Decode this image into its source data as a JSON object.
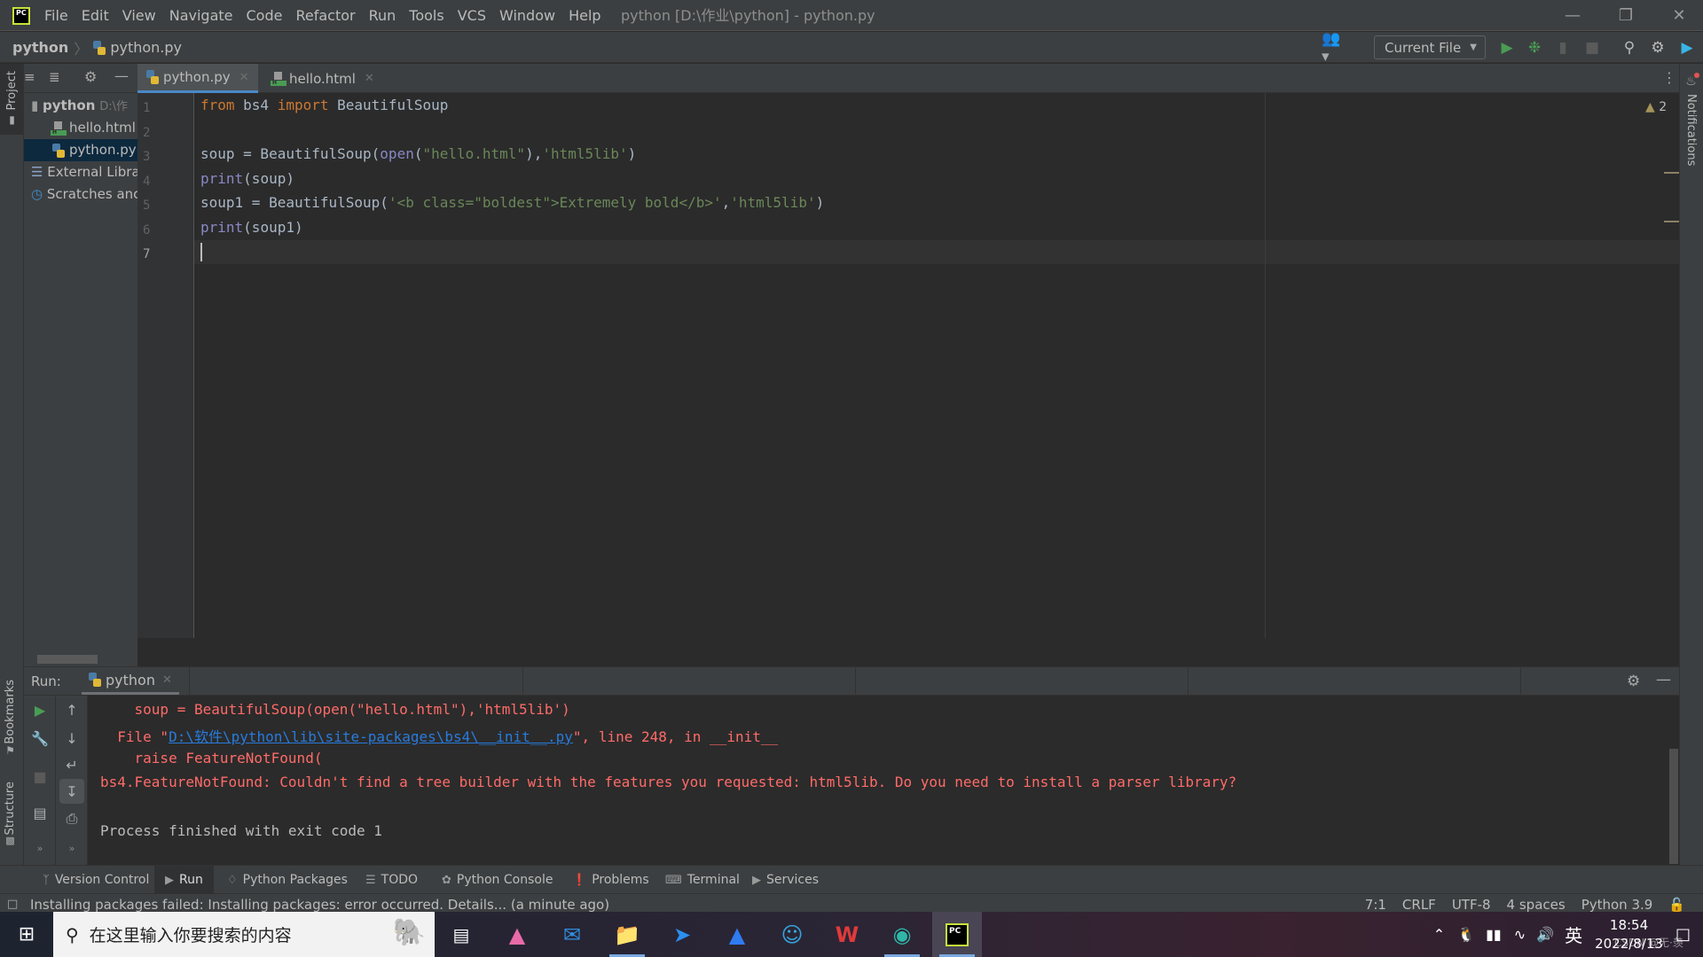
{
  "app": {
    "logo_text": "PC",
    "window_title": "python [D:\\作业\\python] - python.py",
    "menu": [
      "File",
      "Edit",
      "View",
      "Navigate",
      "Code",
      "Refactor",
      "Run",
      "Tools",
      "VCS",
      "Window",
      "Help"
    ],
    "window_controls": {
      "minimize": "minimize-icon",
      "restore": "restore-icon",
      "close": "close-icon"
    }
  },
  "navbar": {
    "breadcrumb_root": "python",
    "breadcrumb_file": "python.py",
    "run_config": "Current File",
    "icons": [
      "vcs-users-icon",
      "run-icon",
      "debug-icon",
      "coverage-icon",
      "stop-icon",
      "search-icon",
      "settings-icon",
      "toolbox-icon"
    ]
  },
  "left_toolwindows": {
    "project": "Project",
    "bookmarks": "Bookmarks",
    "structure": "Structure"
  },
  "right_toolwindows": {
    "notifications": "Notifications"
  },
  "project_tree": [
    {
      "label": "python",
      "hint": "D:\\作",
      "type": "folder",
      "bold": true
    },
    {
      "label": "hello.html",
      "type": "html"
    },
    {
      "label": "python.py",
      "type": "py",
      "selected": true
    },
    {
      "label": "External Libra",
      "type": "library"
    },
    {
      "label": "Scratches anc",
      "type": "scratches"
    }
  ],
  "editor": {
    "tabs": [
      {
        "label": "python.py",
        "active": true,
        "type": "py"
      },
      {
        "label": "hello.html",
        "active": false,
        "type": "html"
      }
    ],
    "line_numbers": [
      "1",
      "2",
      "3",
      "4",
      "5",
      "6",
      "7"
    ],
    "code": [
      [
        {
          "t": "from",
          "c": "kw"
        },
        {
          "t": " bs4 ",
          "c": ""
        },
        {
          "t": "import",
          "c": "kw"
        },
        {
          "t": " BeautifulSoup",
          "c": ""
        }
      ],
      [],
      [
        {
          "t": "soup = BeautifulSoup(",
          "c": ""
        },
        {
          "t": "open",
          "c": "fn"
        },
        {
          "t": "(",
          "c": ""
        },
        {
          "t": "\"hello.html\"",
          "c": "str"
        },
        {
          "t": "),",
          "c": ""
        },
        {
          "t": "'html5lib'",
          "c": "str"
        },
        {
          "t": ")",
          "c": ""
        }
      ],
      [
        {
          "t": "print",
          "c": "fn"
        },
        {
          "t": "(soup)",
          "c": ""
        }
      ],
      [
        {
          "t": "soup1 = BeautifulSoup(",
          "c": ""
        },
        {
          "t": "'<b class=\"boldest\">Extremely bold</b>'",
          "c": "str"
        },
        {
          "t": ",",
          "c": ""
        },
        {
          "t": "'html5lib'",
          "c": "str"
        },
        {
          "t": ")",
          "c": ""
        }
      ],
      [
        {
          "t": "print",
          "c": "fn"
        },
        {
          "t": "(soup1)",
          "c": ""
        }
      ],
      []
    ],
    "warnings_count": "2"
  },
  "run_panel": {
    "label": "Run:",
    "tab": "python",
    "output": [
      {
        "text": "    soup = BeautifulSoup(open(\"hello.html\"),'html5lib')"
      },
      {
        "pre": "  File \"",
        "link": "D:\\软件\\python\\lib\\site-packages\\bs4\\__init__.py",
        "post": "\", line 248, in __init__"
      },
      {
        "text": "    raise FeatureNotFound("
      },
      {
        "text": "bs4.FeatureNotFound: Couldn't find a tree builder with the features you requested: html5lib. Do you need to install a parser library?"
      },
      {
        "text": ""
      },
      {
        "text": "Process finished with exit code 1",
        "normal": true
      }
    ]
  },
  "bottom_tools": [
    {
      "label": "Version Control",
      "icon": "version-control-icon"
    },
    {
      "label": "Run",
      "icon": "run-icon",
      "active": true
    },
    {
      "label": "Python Packages",
      "icon": "packages-icon"
    },
    {
      "label": "TODO",
      "icon": "todo-icon"
    },
    {
      "label": "Python Console",
      "icon": "python-console-icon"
    },
    {
      "label": "Problems",
      "icon": "problems-icon"
    },
    {
      "label": "Terminal",
      "icon": "terminal-icon"
    },
    {
      "label": "Services",
      "icon": "services-icon"
    }
  ],
  "status": {
    "message": "Installing packages failed: Installing packages: error occurred. Details... (a minute ago)",
    "position": "7:1",
    "line_sep": "CRLF",
    "encoding": "UTF-8",
    "indent": "4 spaces",
    "interpreter": "Python 3.9"
  },
  "taskbar": {
    "search_placeholder": "在这里输入你要搜索的内容",
    "apps": [
      "task-view",
      "arc-app",
      "mail",
      "file-explorer",
      "feishu",
      "lark-docs",
      "bilibili",
      "wps",
      "edge",
      "pycharm"
    ],
    "ime": "英",
    "time": "18:54",
    "date": "2022/8/13",
    "watermark": "CSDN @无·羡"
  }
}
